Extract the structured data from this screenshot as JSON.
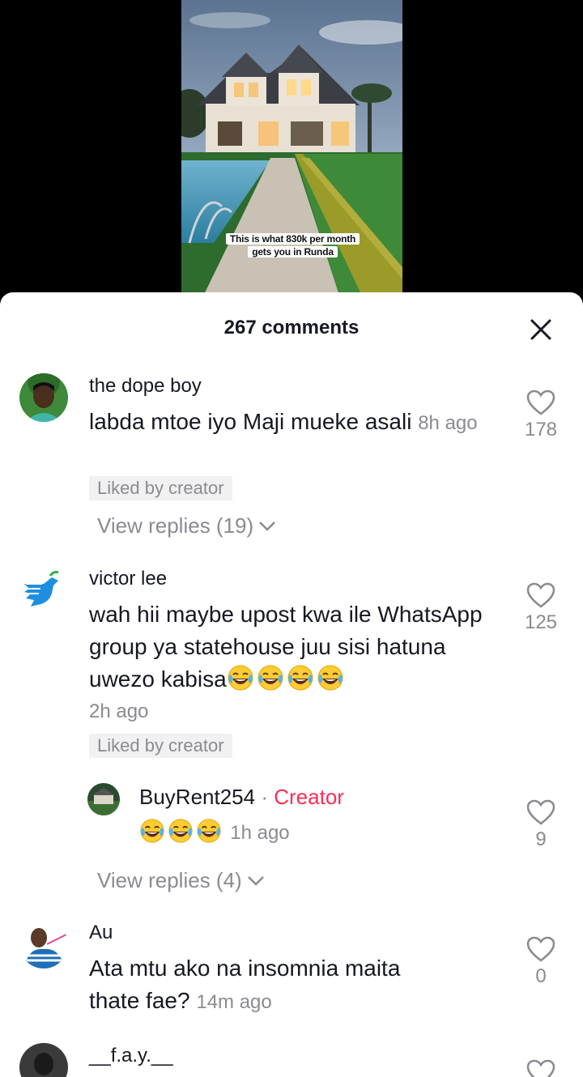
{
  "video": {
    "caption_line1": "This is what 830k per month",
    "caption_line2": "gets you in Runda"
  },
  "sheet": {
    "title": "267 comments",
    "close_icon": "close-icon"
  },
  "comments": [
    {
      "username": "the dope boy",
      "text": "labda mtoe iyo Maji mueke asali",
      "time": "8h ago",
      "badge": "Liked by creator",
      "likes": "178",
      "view_replies": "View replies (19)"
    },
    {
      "username": "victor lee",
      "text": "wah hii maybe upost kwa ile WhatsApp group ya statehouse juu sisi hatuna uwezo kabisa",
      "emoji_count": 4,
      "time": "2h ago",
      "badge": "Liked by creator",
      "likes": "125",
      "reply": {
        "username": "BuyRent254",
        "separator": "·",
        "tag": "Creator",
        "emoji_count": 3,
        "time": "1h ago",
        "likes": "9"
      },
      "view_replies": "View replies (4)"
    },
    {
      "username": "Au",
      "text_line1": "Ata mtu ako na insomnia maita",
      "text_line2": "thate fae?",
      "time": "14m ago",
      "likes": "0"
    },
    {
      "username": "__f.a.y.__"
    }
  ],
  "colors": {
    "accent_creator": "#fe2c55",
    "text_primary": "#161823",
    "text_secondary": "#8a8b91",
    "badge_bg": "#f1f1f2"
  }
}
